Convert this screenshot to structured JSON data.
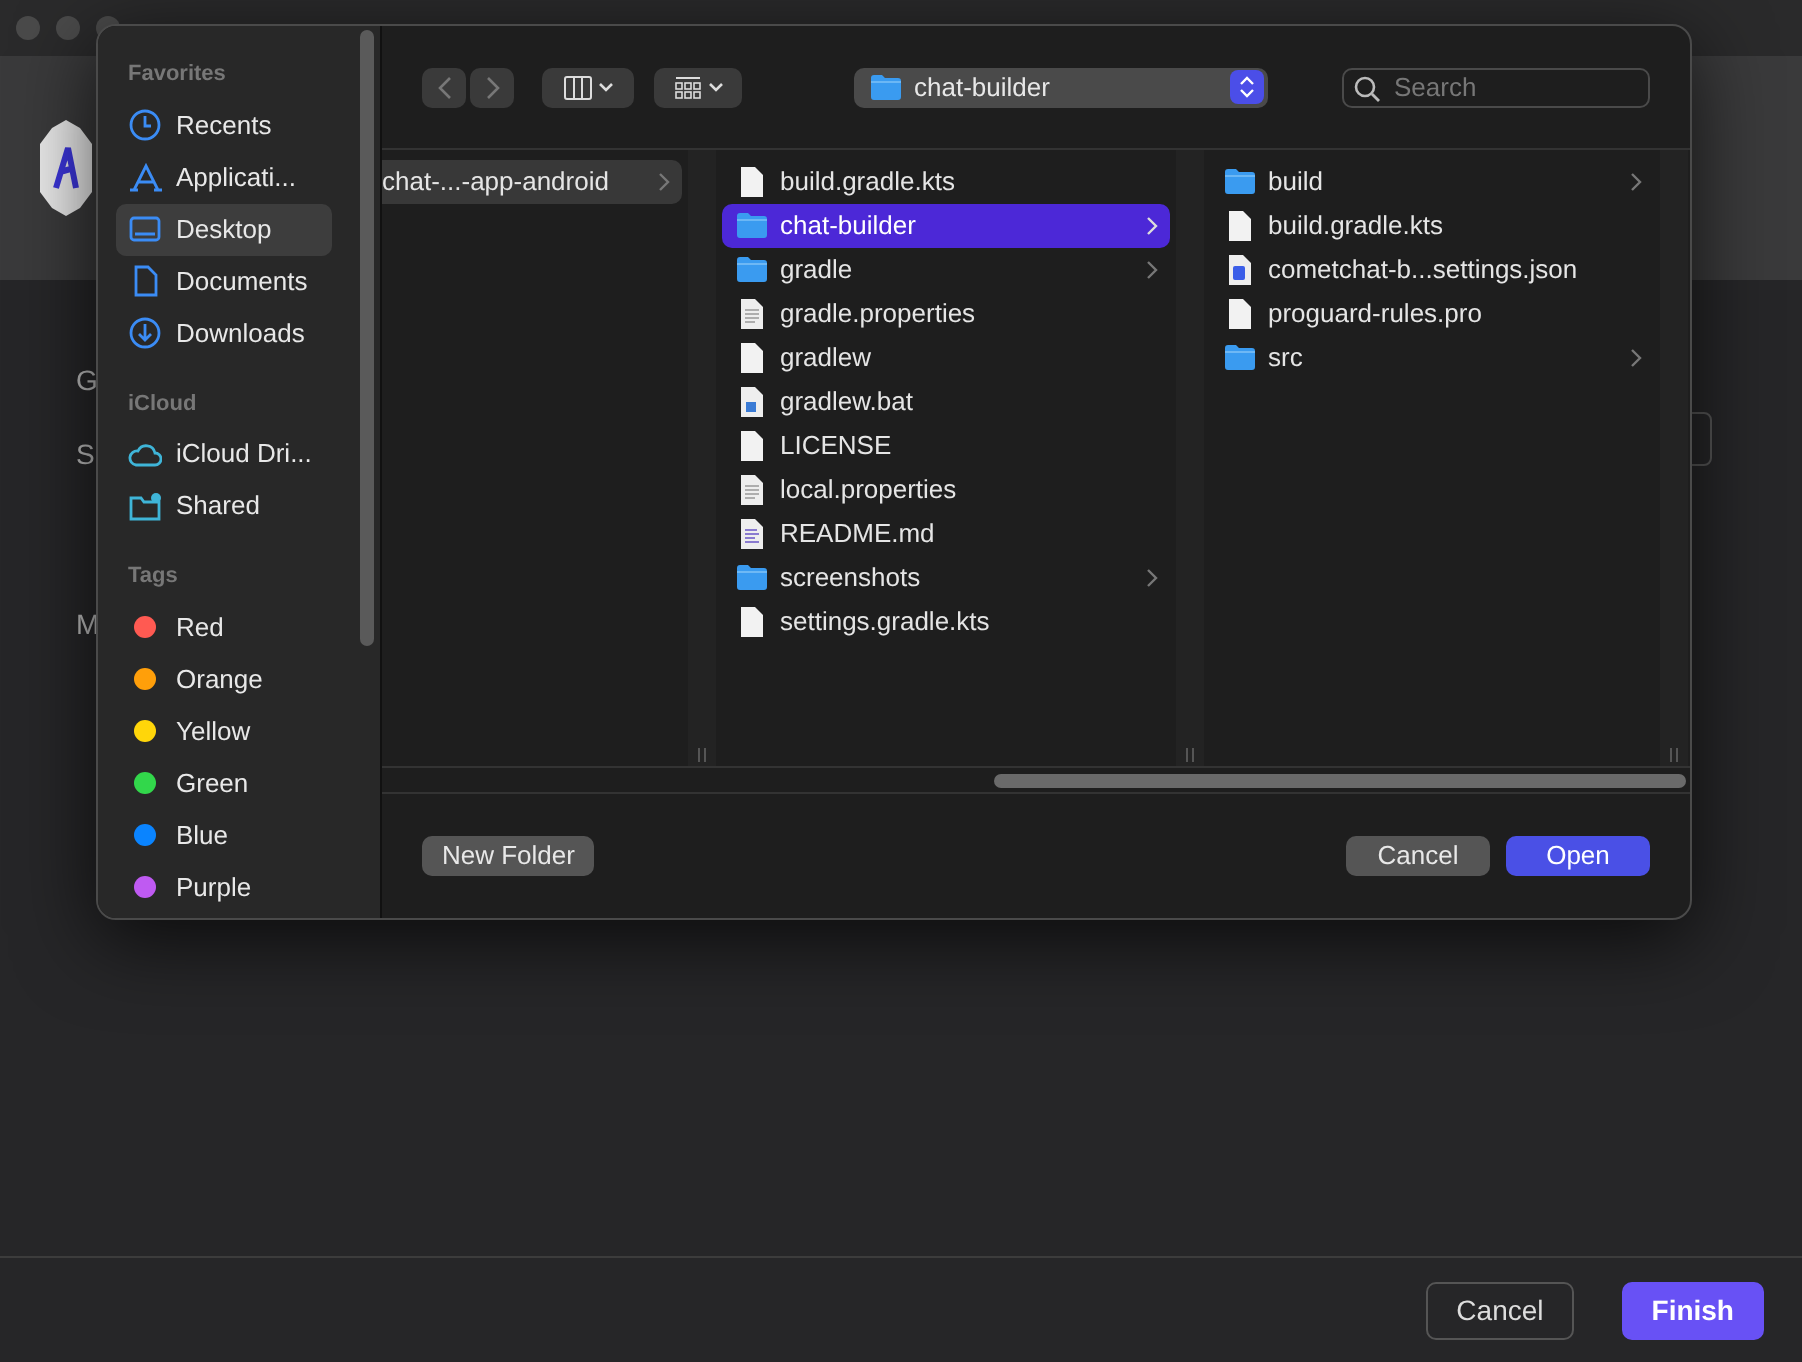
{
  "background_window": {
    "labels": [
      "G",
      "S",
      "M"
    ],
    "buttons": [
      {
        "label": "Cancel",
        "kind": "secondary"
      },
      {
        "label": "Finish",
        "kind": "primary"
      }
    ]
  },
  "dialog": {
    "toolbar": {
      "location": "chat-builder",
      "search": {
        "placeholder": "Search"
      }
    },
    "sidebar": [
      {
        "title": "Favorites",
        "items": [
          {
            "label": "Recents",
            "kind": "recents",
            "selected": false
          },
          {
            "label": "Applicati...",
            "kind": "apps",
            "selected": false
          },
          {
            "label": "Desktop",
            "kind": "desktop",
            "selected": true
          },
          {
            "label": "Documents",
            "kind": "document",
            "selected": false
          },
          {
            "label": "Downloads",
            "kind": "downloads",
            "selected": false
          }
        ]
      },
      {
        "title": "iCloud",
        "items": [
          {
            "label": "iCloud Dri...",
            "kind": "cloud",
            "selected": false
          },
          {
            "label": "Shared",
            "kind": "shared",
            "selected": false
          }
        ]
      },
      {
        "title": "Tags",
        "items": [
          {
            "label": "Red",
            "kind": "tag",
            "color": "#ff5a52",
            "selected": false
          },
          {
            "label": "Orange",
            "kind": "tag",
            "color": "#ff9f0a",
            "selected": false
          },
          {
            "label": "Yellow",
            "kind": "tag",
            "color": "#ffd60a",
            "selected": false
          },
          {
            "label": "Green",
            "kind": "tag",
            "color": "#32d74b",
            "selected": false
          },
          {
            "label": "Blue",
            "kind": "tag",
            "color": "#0a84ff",
            "selected": false
          },
          {
            "label": "Purple",
            "kind": "tag",
            "color": "#bf5af2",
            "selected": false
          }
        ]
      }
    ],
    "columns": [
      {
        "active": false,
        "clipped": true,
        "items": [
          {
            "name": "chat-...-app-android",
            "kind": "folder",
            "selected": true
          }
        ]
      },
      {
        "active": true,
        "clipped": false,
        "items": [
          {
            "name": "build.gradle.kts",
            "kind": "file",
            "selected": false
          },
          {
            "name": "chat-builder",
            "kind": "folder",
            "selected": true
          },
          {
            "name": "gradle",
            "kind": "folder",
            "selected": false
          },
          {
            "name": "gradle.properties",
            "kind": "text",
            "selected": false
          },
          {
            "name": "gradlew",
            "kind": "file",
            "selected": false
          },
          {
            "name": "gradlew.bat",
            "kind": "bat",
            "selected": false
          },
          {
            "name": "LICENSE",
            "kind": "file",
            "selected": false
          },
          {
            "name": "local.properties",
            "kind": "text",
            "selected": false
          },
          {
            "name": "README.md",
            "kind": "markdown",
            "selected": false
          },
          {
            "name": "screenshots",
            "kind": "folder",
            "selected": false
          },
          {
            "name": "settings.gradle.kts",
            "kind": "file",
            "selected": false
          }
        ]
      },
      {
        "clipped": false,
        "items": [
          {
            "name": "build",
            "kind": "folder",
            "selected": false
          },
          {
            "name": "build.gradle.kts",
            "kind": "file",
            "selected": false
          },
          {
            "name": "cometchat-b...settings.json",
            "kind": "json",
            "selected": false
          },
          {
            "name": "proguard-rules.pro",
            "kind": "file",
            "selected": false
          },
          {
            "name": "src",
            "kind": "folder",
            "selected": false
          }
        ]
      }
    ],
    "buttons": [
      {
        "label": "New Folder",
        "kind": "left"
      },
      {
        "label": "Cancel",
        "kind": "cancel"
      },
      {
        "label": "Open",
        "kind": "default"
      }
    ]
  }
}
